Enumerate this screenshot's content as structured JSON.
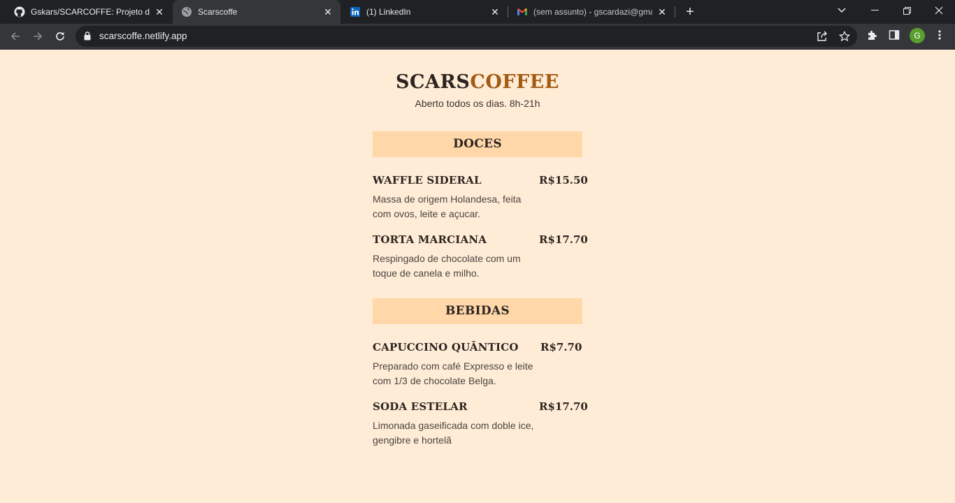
{
  "browser": {
    "tabs": [
      {
        "title": "Gskars/SCARCOFFE: Projeto do \"",
        "icon": "github-icon"
      },
      {
        "title": "Scarscoffe",
        "icon": "globe-icon"
      },
      {
        "title": "(1) LinkedIn",
        "icon": "linkedin-icon"
      },
      {
        "title": "(sem assunto) - gscardazi@gmail",
        "icon": "gmail-icon"
      }
    ],
    "url": "scarscoffe.netlify.app",
    "profile_initial": "G"
  },
  "page": {
    "brand_dark": "SCARS",
    "brand_accent": "COFFEE",
    "hours": "Aberto todos os dias. 8h-21h",
    "sections": [
      {
        "title": "DOCES",
        "items": [
          {
            "name": "WAFFLE SIDERAL",
            "price": "R$15.50",
            "description": "Massa de origem Holandesa, feita com ovos, leite e açucar."
          },
          {
            "name": "TORTA MARCIANA",
            "price": "R$17.70",
            "description": "Respingado de chocolate com um toque de canela e milho."
          }
        ]
      },
      {
        "title": "BEBIDAS",
        "items": [
          {
            "name": "CAPUCCINO QUÂNTICO",
            "price": "R$7.70",
            "description": "Preparado com café Expresso e leite com 1/3 de chocolate Belga."
          },
          {
            "name": "SODA ESTELAR",
            "price": "R$17.70",
            "description": "Limonada gaseificada com doble ice, gengibre e hortelã"
          }
        ]
      }
    ]
  },
  "colors": {
    "page_background": "#ffecd6",
    "section_band": "#ffd7a9",
    "brand_accent": "#a35a12",
    "text_dark": "#2c2420"
  }
}
